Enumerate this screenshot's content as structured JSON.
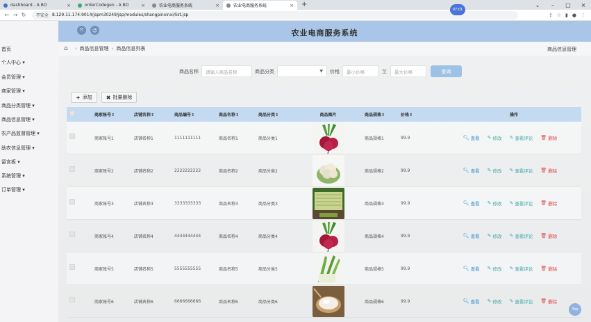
{
  "browser": {
    "tabs": [
      {
        "title": "dashboard - A BO",
        "color": "#3b73d1"
      },
      {
        "title": "orderCodegen - A BO",
        "color": "#3fa86b"
      },
      {
        "title": "农业电商服务系统",
        "color": "#888888"
      },
      {
        "title": "农业电商服务系统",
        "color": "#888888"
      }
    ],
    "insecure_label": "不安全",
    "url": "8.129.11.174:9014/jspm30249/jsp/modules/shangpinxinxi/list.jsp",
    "clock": "07:01"
  },
  "sidebar": {
    "items": [
      {
        "label": "首页"
      },
      {
        "label": "个人中心"
      },
      {
        "label": "会员管理"
      },
      {
        "label": "商家管理"
      },
      {
        "label": "商品分类管理"
      },
      {
        "label": "商品信息管理"
      },
      {
        "label": "农产品监督管理"
      },
      {
        "label": "助农信息管理"
      },
      {
        "label": "留言板"
      },
      {
        "label": "系统管理"
      },
      {
        "label": "订单管理"
      }
    ]
  },
  "header": {
    "title": "农业电商服务系统"
  },
  "breadcrumb": {
    "level1": "商品信息管理",
    "level2": "商品信息列表",
    "right": "商品信息管理"
  },
  "search": {
    "name_label": "商品名称",
    "name_placeholder": "请输入商品名称",
    "category_label": "商品分类",
    "price_label": "价格",
    "min_placeholder": "最小价格",
    "max_placeholder": "最大价格",
    "query_label": "查询"
  },
  "toolbar": {
    "add_label": "添加",
    "batch_delete_label": "批量删除"
  },
  "table": {
    "headers": [
      "商家账号⇕",
      "店铺名称⇕",
      "商品编号⇕",
      "商品名称⇕",
      "商品分类⇕",
      "商品图片",
      "商品规格⇕",
      "价格⇕",
      "操作"
    ],
    "op_labels": {
      "view": "查看",
      "edit": "修改",
      "comment": "查看评论",
      "delete": "删除"
    },
    "rows": [
      {
        "account": "商家账号1",
        "shop": "店铺名称1",
        "code": "1111111111",
        "name": "商品名称1",
        "category": "商品分类1",
        "spec": "商品规格1",
        "price": "99.9",
        "image": "beet"
      },
      {
        "account": "商家账号2",
        "shop": "店铺名称2",
        "code": "2222222222",
        "name": "商品名称2",
        "category": "商品分类2",
        "spec": "商品规格2",
        "price": "99.9",
        "image": "cauliflower"
      },
      {
        "account": "商家账号3",
        "shop": "店铺名称3",
        "code": "3333333333",
        "name": "商品名称3",
        "category": "商品分类3",
        "spec": "商品规格3",
        "price": "99.9",
        "image": "celery"
      },
      {
        "account": "商家账号4",
        "shop": "店铺名称4",
        "code": "4444444444",
        "name": "商品名称4",
        "category": "商品分类4",
        "spec": "商品规格4",
        "price": "99.9",
        "image": "beet"
      },
      {
        "account": "商家账号5",
        "shop": "店铺名称5",
        "code": "5555555555",
        "name": "商品名称5",
        "category": "商品分类5",
        "spec": "商品规格5",
        "price": "99.9",
        "image": "greens"
      },
      {
        "account": "商家账号6",
        "shop": "店铺名称6",
        "code": "6666666666",
        "name": "商品名称6",
        "category": "商品分类6",
        "spec": "商品规格6",
        "price": "99.9",
        "image": "rice"
      }
    ]
  },
  "back_to_top": "Top"
}
